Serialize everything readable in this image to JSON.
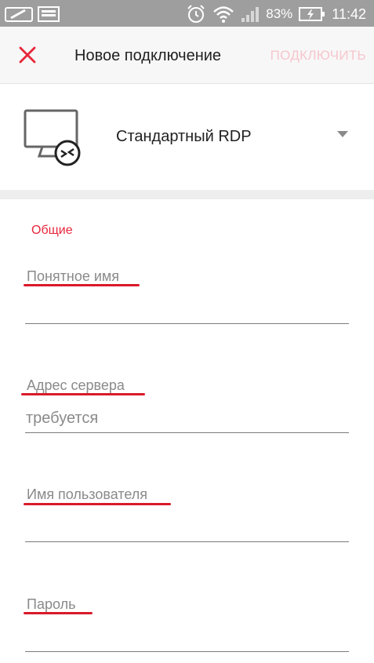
{
  "status_bar": {
    "battery_percent": "83%",
    "time": "11:42"
  },
  "toolbar": {
    "title": "Новое подключение",
    "connect_label": "ПОДКЛЮЧИТЬ"
  },
  "connection_type": {
    "selected": "Стандартный RDP"
  },
  "form": {
    "section_title": "Общие",
    "friendly_name": {
      "label": "Понятное имя",
      "value": "",
      "placeholder": ""
    },
    "server_address": {
      "label": "Адрес сервера",
      "value": "",
      "placeholder": "требуется"
    },
    "username": {
      "label": "Имя пользователя",
      "value": "",
      "placeholder": ""
    },
    "password": {
      "label": "Пароль",
      "value": "",
      "placeholder": ""
    }
  },
  "colors": {
    "accent": "#e8263a",
    "connect_disabled": "#f6c6cd",
    "status_bar": "#9e9e9e",
    "annotation_underline": "#d91a2a"
  }
}
